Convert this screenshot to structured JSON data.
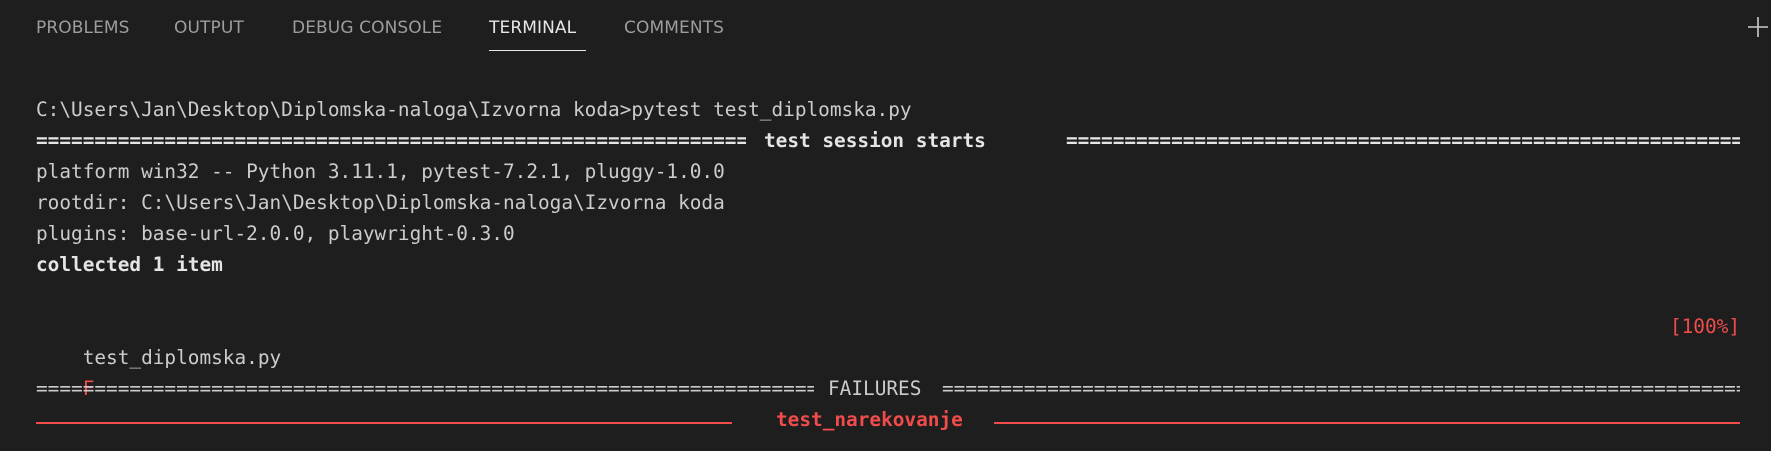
{
  "panel": {
    "tabs": [
      {
        "label": "PROBLEMS",
        "active": false
      },
      {
        "label": "OUTPUT",
        "active": false
      },
      {
        "label": "DEBUG CONSOLE",
        "active": false
      },
      {
        "label": "TERMINAL",
        "active": true
      },
      {
        "label": "COMMENTS",
        "active": false
      }
    ],
    "new_terminal_icon": "plus-icon"
  },
  "terminal": {
    "command_line": "C:\\Users\\Jan\\Desktop\\Diplomska-naloga\\Izvorna koda>pytest test_diplomska.py",
    "session_header": "test session starts",
    "platform": "platform win32 -- Python 3.11.1, pytest-7.2.1, pluggy-1.0.0",
    "rootdir": "rootdir: C:\\Users\\Jan\\Desktop\\Diplomska-naloga\\Izvorna koda",
    "plugins": "plugins: base-url-2.0.0, playwright-0.3.0",
    "collected": "collected 1 item",
    "test_file": "test_diplomska.py",
    "test_result": "F",
    "progress": "[100%]",
    "failures_header": "FAILURES",
    "failed_test": "test_narekovanje"
  },
  "colors": {
    "background": "#1e1e1e",
    "text": "#cccccc",
    "failure_red": "#f14c4c",
    "active_tab": "#e7e7e7",
    "inactive_tab": "#9d9d9d"
  }
}
